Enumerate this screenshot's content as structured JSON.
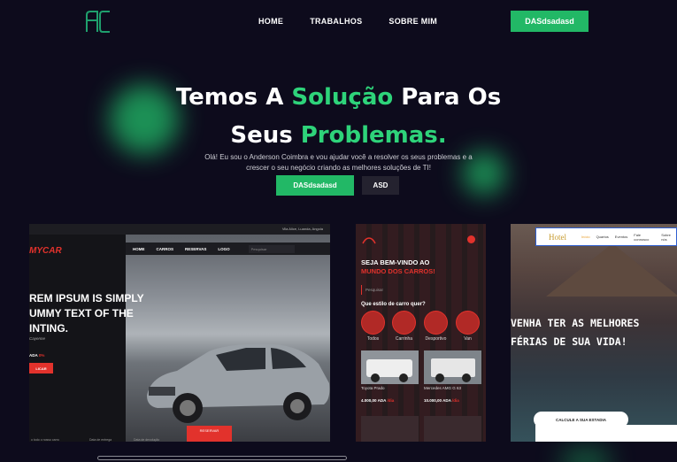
{
  "nav": {
    "logo_text": "AC",
    "links": [
      "HOME",
      "TRABALHOS",
      "SOBRE MIM"
    ],
    "cta_label": "DASdsadasd"
  },
  "hero": {
    "title_line1_a": "Temos A ",
    "title_line1_hl": "Solução",
    "title_line1_b": " Para Os",
    "title_line2_a": "Seus ",
    "title_line2_hl": "Problemas.",
    "subtitle": "Olá! Eu sou o Anderson Coimbra e vou ajudar você a resolver os seus problemas e a crescer o seu negócio criando as melhores soluções de TI!",
    "primary_button": "DASdsadasd",
    "secondary_button": "ASD"
  },
  "colors": {
    "accent": "#22b866",
    "accent_text": "#2ed37a",
    "background": "#0d0b1c",
    "red": "#e2322c"
  },
  "projects": {
    "mycar": {
      "logo": "MYCAR",
      "location": "Vila Alice, Luanda, Angola",
      "menu": [
        "HOME",
        "CARROS",
        "RESERVAS",
        "LOGO"
      ],
      "search_placeholder": "Pesquisar",
      "headline": "REM IPSUM IS SIMPLY UMMY TEXT OF THE INTING.",
      "subline": "Cayenne",
      "price": "ADA",
      "price_hl": "0%",
      "button": "LICAR",
      "red_button": "RESERVAR",
      "footer": [
        "o todo o nosso carro",
        "Data de entrega",
        "Data de devolução"
      ]
    },
    "mobile": {
      "welcome": "SEJA BEM-VINDO AO",
      "welcome_hl": "MUNDO DOS CARROS!",
      "search_placeholder": "Pesquisar",
      "question": "Que estilo de carro quer?",
      "categories": [
        "Todos",
        "Carrinha",
        "Desportivo",
        "Van"
      ],
      "cars": [
        {
          "name": "Toyota Prado",
          "price": "4.000,00 ADA",
          "period": "/dia"
        },
        {
          "name": "Mercedes AMG G 63",
          "price": "10.000,00 ADA",
          "period": "/dia"
        }
      ]
    },
    "hotel": {
      "brand": "Hotel",
      "menu": [
        "Início",
        "Quartos",
        "Eventos",
        "Fale connosco",
        "Sobre nós"
      ],
      "title": "VENHA TER AS MELHORES FÉRIAS DE SUA VIDA!",
      "calc_button": "CALCULE A SUA ESTADIA"
    }
  }
}
